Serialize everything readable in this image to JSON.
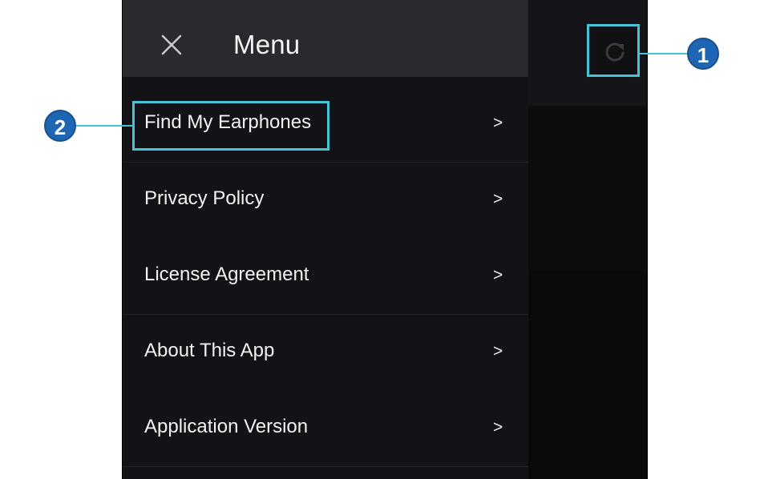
{
  "menu": {
    "title": "Menu",
    "items": [
      {
        "label": "Find My Earphones",
        "chevron": ">"
      },
      {
        "label": "Privacy Policy",
        "chevron": ">"
      },
      {
        "label": "License Agreement",
        "chevron": ">"
      },
      {
        "label": "About This App",
        "chevron": ">"
      },
      {
        "label": "Application Version",
        "chevron": ">"
      }
    ]
  },
  "icons": {
    "close": "close-icon",
    "refresh": "refresh-icon"
  },
  "callouts": [
    {
      "number": "1",
      "target": "refresh-button"
    },
    {
      "number": "2",
      "target": "menu-item-find-my-earphones"
    }
  ],
  "colors": {
    "highlight": "#46c3d6",
    "badge": "#1e66b4",
    "drawer_background": "#131217",
    "header_background": "#2a292e"
  }
}
